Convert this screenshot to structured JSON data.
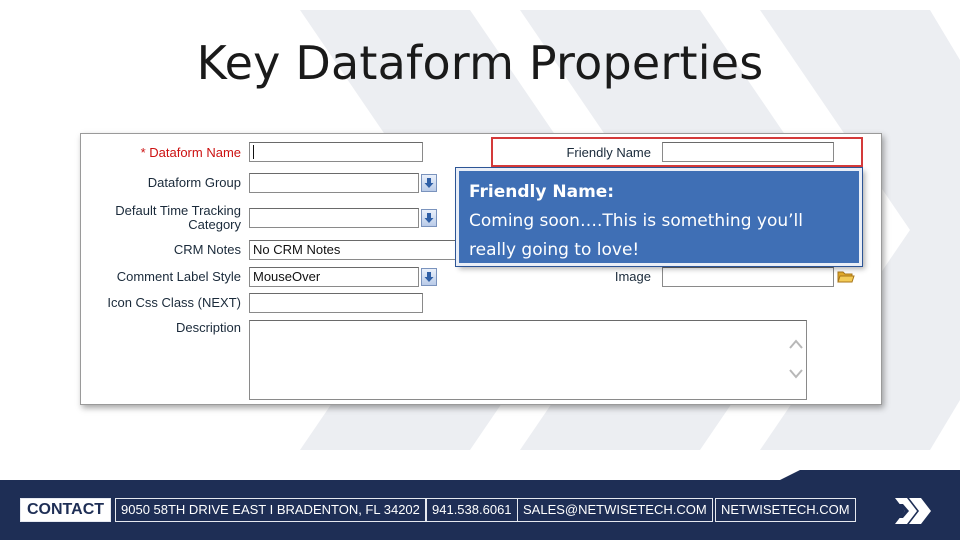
{
  "slide": {
    "title": "Key Dataform Properties"
  },
  "form": {
    "fields": [
      {
        "label": "* Dataform Name",
        "value": ""
      },
      {
        "label": "Dataform Group",
        "value": ""
      },
      {
        "label": "Default Time Tracking Category",
        "value": ""
      },
      {
        "label": "CRM Notes",
        "value": "No CRM Notes"
      },
      {
        "label": "Comment Label Style",
        "value": "MouseOver"
      },
      {
        "label": "Icon Css Class (NEXT)",
        "value": ""
      },
      {
        "label": "Description",
        "value": ""
      }
    ],
    "right_fields": [
      {
        "label": "Friendly Name",
        "value": ""
      },
      {
        "label": "Image",
        "value": ""
      }
    ]
  },
  "tooltip": {
    "title": "Friendly Name:",
    "body": "Coming soon….This is something you’ll really going to love!"
  },
  "footer": {
    "contact": "CONTACT",
    "address": "9050 58TH DRIVE EAST I BRADENTON, FL 34202",
    "phone": "941.538.6061",
    "email": "SALES@NETWISETECH.COM",
    "website": "NETWISETECH.COM"
  },
  "colors": {
    "footer_bg": "#1e2e55",
    "tooltip_bg": "#3f6fb5",
    "highlight": "#d43a3a",
    "required_label": "#cc1111"
  },
  "icons": [
    "dropdown-arrow-icon",
    "folder-icon",
    "scroll-up-icon",
    "scroll-down-icon",
    "netwise-logo-icon"
  ]
}
